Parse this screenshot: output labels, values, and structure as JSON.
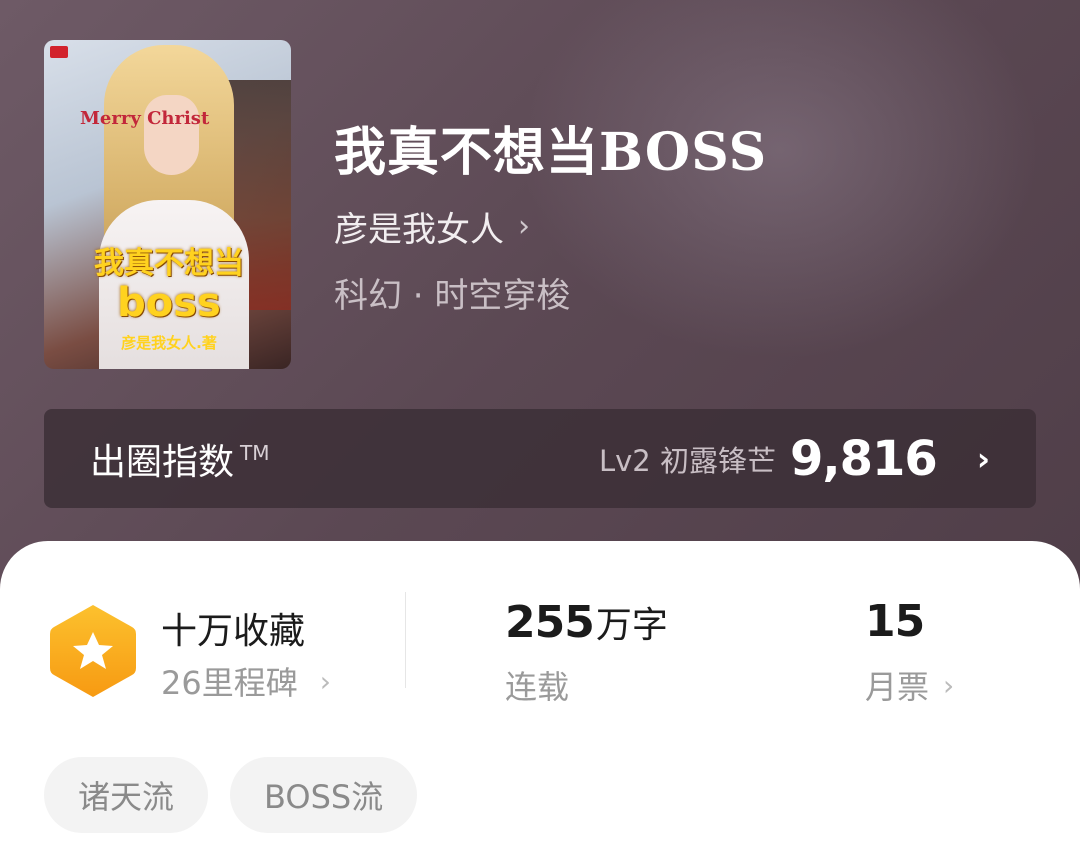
{
  "book": {
    "title": "我真不想当BOSS",
    "author": "彦是我女人",
    "genre": "科幻 · 时空穿梭"
  },
  "cover": {
    "title_text": "我真不想当",
    "boss_text": "boss",
    "author_text": "彦是我女人.著",
    "xmas_text": "Merry Christ"
  },
  "index": {
    "label": "出圈指数",
    "tm": "TM",
    "level": "Lv2 初露锋芒",
    "value": "9,816"
  },
  "stats": {
    "collection_title": "十万收藏",
    "milestone": "26里程碑",
    "word_count": "255",
    "word_unit": "万字",
    "status": "连载",
    "monthly_tickets": "15",
    "tickets_label": "月票"
  },
  "tags": [
    "诸天流",
    "BOSS流"
  ],
  "icons": {
    "chevron": "chevron-right-icon",
    "badge": "star-hexagon-icon"
  },
  "colors": {
    "badge_orange": "#fbb020",
    "header_bg": "#5b4853",
    "card_bg": "#ffffff"
  }
}
